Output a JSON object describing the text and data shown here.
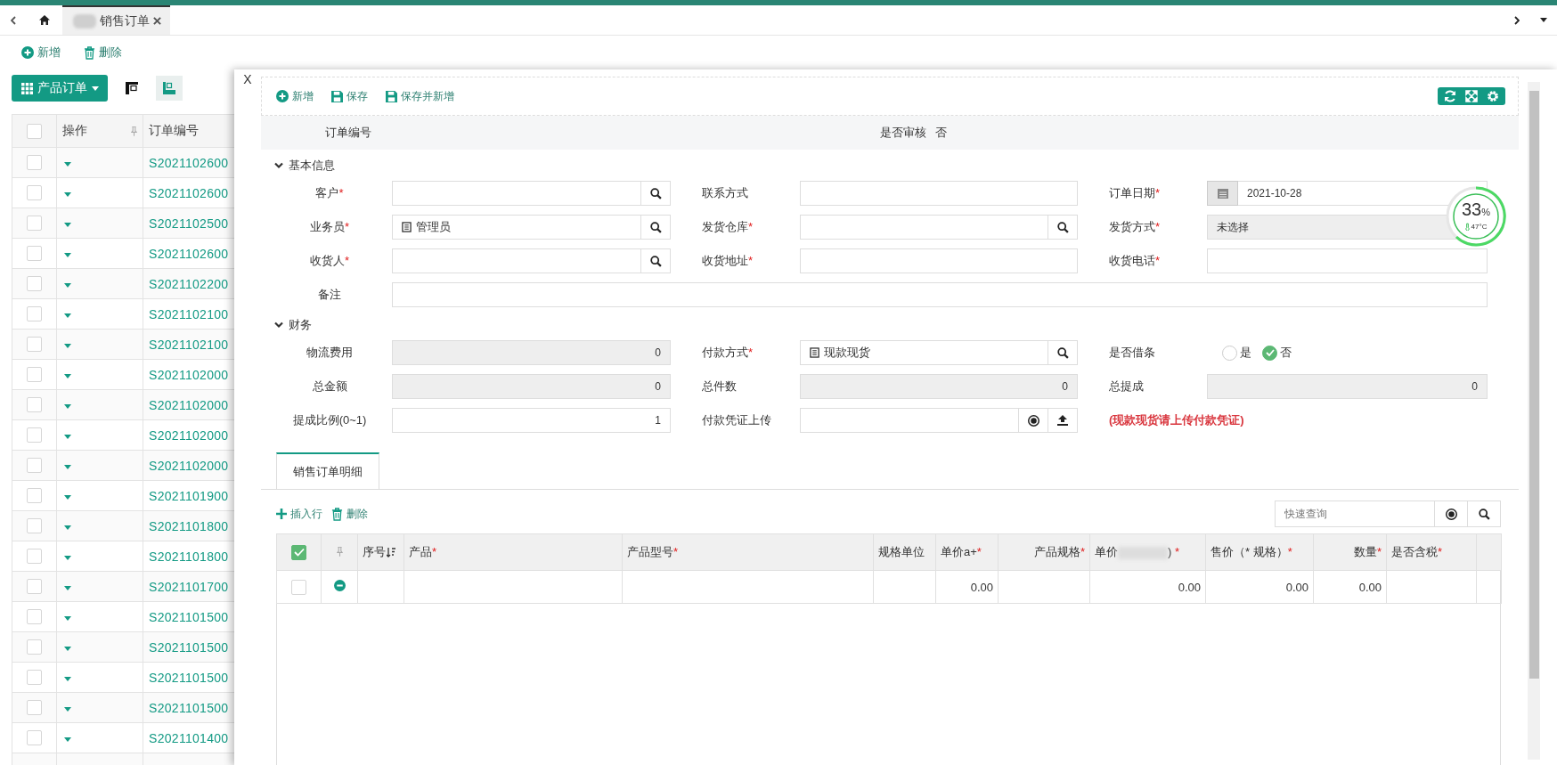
{
  "page_tabs": [
    {
      "label": "销售订单",
      "selected": true
    }
  ],
  "toolbar": [
    {
      "kind": "add",
      "label": "新增"
    },
    {
      "kind": "delete",
      "label": "删除"
    }
  ],
  "view_menu": {
    "label": "产品订单"
  },
  "view_toggles": [
    {
      "kind": "top",
      "selected": false
    },
    {
      "kind": "left",
      "selected": true
    }
  ],
  "list": {
    "header_checked": false,
    "columns": [
      "操作",
      "订单编号"
    ],
    "rows": [
      {
        "checked": false,
        "order_no": "S2021102600"
      },
      {
        "checked": false,
        "order_no": "S2021102600"
      },
      {
        "checked": false,
        "order_no": "S2021102500"
      },
      {
        "checked": false,
        "order_no": "S2021102600"
      },
      {
        "checked": false,
        "order_no": "S2021102200"
      },
      {
        "checked": false,
        "order_no": "S2021102100"
      },
      {
        "checked": false,
        "order_no": "S2021102100"
      },
      {
        "checked": false,
        "order_no": "S2021102000"
      },
      {
        "checked": false,
        "order_no": "S2021102000"
      },
      {
        "checked": false,
        "order_no": "S2021102000"
      },
      {
        "checked": false,
        "order_no": "S2021102000"
      },
      {
        "checked": false,
        "order_no": "S2021101900"
      },
      {
        "checked": false,
        "order_no": "S2021101800"
      },
      {
        "checked": false,
        "order_no": "S2021101800"
      },
      {
        "checked": false,
        "order_no": "S2021101700"
      },
      {
        "checked": false,
        "order_no": "S2021101500"
      },
      {
        "checked": false,
        "order_no": "S2021101500"
      },
      {
        "checked": false,
        "order_no": "S2021101500"
      },
      {
        "checked": false,
        "order_no": "S2021101500"
      },
      {
        "checked": false,
        "order_no": "S2021101400"
      }
    ]
  },
  "dialog": {
    "close": "X",
    "required_mark": "*",
    "toolbar": [
      {
        "kind": "add",
        "label": "新增"
      },
      {
        "kind": "save",
        "label": "保存"
      },
      {
        "kind": "save",
        "label": "保存并新增"
      }
    ],
    "header": [
      {
        "label": "订单编号"
      },
      {
        "label": "是否审核",
        "value": "否"
      }
    ],
    "sections": [
      {
        "title": "基本信息",
        "expanded": true,
        "fields": [
          {
            "kind": "lookup",
            "label": "客户",
            "required": true
          },
          {
            "kind": "text",
            "label": "联系方式",
            "required": false
          },
          {
            "kind": "date",
            "label": "订单日期",
            "required": true,
            "value": "2021-10-28"
          },
          {
            "kind": "lookup",
            "label": "业务员",
            "required": true,
            "value": "管理员"
          },
          {
            "kind": "lookup",
            "label": "发货仓库",
            "required": true
          },
          {
            "kind": "select",
            "label": "发货方式",
            "required": true,
            "value": "未选择",
            "disabled": true
          },
          {
            "kind": "lookup",
            "label": "收货人",
            "required": true
          },
          {
            "kind": "text",
            "label": "收货地址",
            "required": true
          },
          {
            "kind": "text",
            "label": "收货电话",
            "required": true
          },
          {
            "kind": "textarea",
            "label": "备注",
            "required": false
          }
        ]
      },
      {
        "title": "财务",
        "expanded": true,
        "fields": [
          {
            "kind": "number",
            "label": "物流费用",
            "required": false,
            "value": "0",
            "disabled": true
          },
          {
            "kind": "lookup",
            "label": "付款方式",
            "required": true,
            "value": "现款现货"
          },
          {
            "kind": "radio",
            "label": "是否借条",
            "required": false,
            "options": [
              {
                "label": "是",
                "selected": false
              },
              {
                "label": "否",
                "selected": true
              }
            ]
          },
          {
            "kind": "number",
            "label": "总金额",
            "required": false,
            "value": "0",
            "disabled": true
          },
          {
            "kind": "number",
            "label": "总件数",
            "required": false,
            "value": "0",
            "disabled": true
          },
          {
            "kind": "number",
            "label": "总提成",
            "required": false,
            "value": "0",
            "disabled": true
          },
          {
            "kind": "number",
            "label": "提成比例(0~1)",
            "required": false,
            "value": "1",
            "disabled": false
          },
          {
            "kind": "upload",
            "label": "付款凭证上传",
            "required": false
          },
          {
            "kind": "note",
            "text": "(现款现货请上传付款凭证)"
          }
        ]
      }
    ],
    "detail_tabs": [
      {
        "label": "销售订单明细",
        "selected": true
      }
    ],
    "detail_toolbar": [
      {
        "kind": "insert",
        "label": "插入行"
      },
      {
        "kind": "delete",
        "label": "删除"
      }
    ],
    "detail_search": {
      "placeholder": "快速查询"
    },
    "detail_table": {
      "header_checked": true,
      "columns": [
        {
          "kind": "check"
        },
        {
          "kind": "pin"
        },
        {
          "kind": "sort",
          "label": "序号"
        },
        {
          "kind": "text",
          "label": "产品",
          "required": true
        },
        {
          "kind": "text",
          "label": "产品型号",
          "required": true
        },
        {
          "kind": "text",
          "label": "规格单位",
          "required": false
        },
        {
          "kind": "text",
          "label": "单价a+",
          "required": true
        },
        {
          "kind": "text",
          "label": "产品规格",
          "required": true
        },
        {
          "kind": "redacted",
          "label": "单价",
          "tail": ")",
          "required": true
        },
        {
          "kind": "text",
          "label": "售价（* 规格）",
          "required": true
        },
        {
          "kind": "text",
          "label": "数量",
          "required": true
        },
        {
          "kind": "text",
          "label": "是否含税",
          "required": true
        },
        {
          "kind": "blank"
        }
      ],
      "rows": [
        {
          "checked": false,
          "price_a": "0.00",
          "price": "0.00",
          "sale_price": "0.00",
          "quantity": "0.00"
        }
      ]
    },
    "monitor": {
      "value": "33",
      "unit": "%",
      "temperature": "47°C"
    }
  }
}
